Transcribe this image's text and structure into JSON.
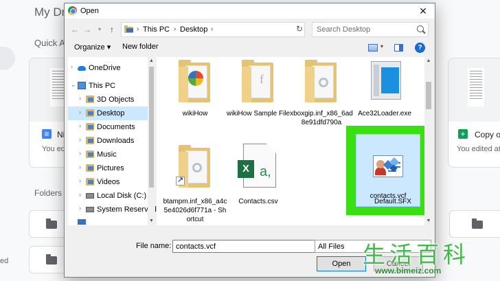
{
  "background": {
    "drive_title": "My Dri",
    "quick_access": "Quick A",
    "folders": "Folders",
    "card_left_name": "Ni",
    "card_left_sub": "You edi",
    "card_right_name": "Copy of",
    "card_right_sub": "You edited at",
    "edge_left": "ed"
  },
  "dialog": {
    "title": "Open",
    "close_glyph": "✕",
    "address": [
      "This PC",
      "Desktop"
    ],
    "search_placeholder": "Search Desktop",
    "toolbar": {
      "organize": "Organize ▾",
      "new_folder": "New folder",
      "help": "?"
    },
    "nav_items": [
      {
        "label": "OneDrive",
        "icon": "cloud-icon"
      },
      {
        "label": "This PC",
        "icon": "computer-icon"
      },
      {
        "label": "3D Objects",
        "icon": "folder-icon"
      },
      {
        "label": "Desktop",
        "icon": "folder-icon",
        "selected": true
      },
      {
        "label": "Documents",
        "icon": "folder-icon"
      },
      {
        "label": "Downloads",
        "icon": "folder-icon"
      },
      {
        "label": "Music",
        "icon": "folder-icon"
      },
      {
        "label": "Pictures",
        "icon": "folder-icon"
      },
      {
        "label": "Videos",
        "icon": "folder-icon"
      },
      {
        "label": "Local Disk (C:)",
        "icon": "disk-icon"
      },
      {
        "label": "System Reserved",
        "icon": "disk-icon"
      }
    ],
    "files": [
      {
        "label": "wikiHow",
        "kind": "folder"
      },
      {
        "label": "wikiHow Sample File",
        "kind": "folder"
      },
      {
        "label": "xboxgip.inf_x86_6ad8e91dfd790a",
        "kind": "folder"
      },
      {
        "label": "Ace32Loader.exe",
        "kind": "application"
      },
      {
        "label": "btampm.inf_x86_a4c5e4026d6f771a - Shortcut",
        "kind": "shortcut"
      },
      {
        "label": "Contacts.csv",
        "kind": "csv"
      },
      {
        "label": "contacts.vcf",
        "kind": "vcf",
        "selected": true
      },
      {
        "label": "Default.SFX",
        "kind": "sfx"
      }
    ],
    "file_name_label": "File name:",
    "file_name_value": "contacts.vcf",
    "file_type": "All Files",
    "open_label": "Open",
    "cancel_label": "Cancel"
  },
  "watermark": {
    "chars": "生活百科",
    "url": "www.bimeiz.com"
  },
  "colors": {
    "highlight": "#39e011",
    "selection": "#cce8ff",
    "accent": "#0078d7"
  }
}
